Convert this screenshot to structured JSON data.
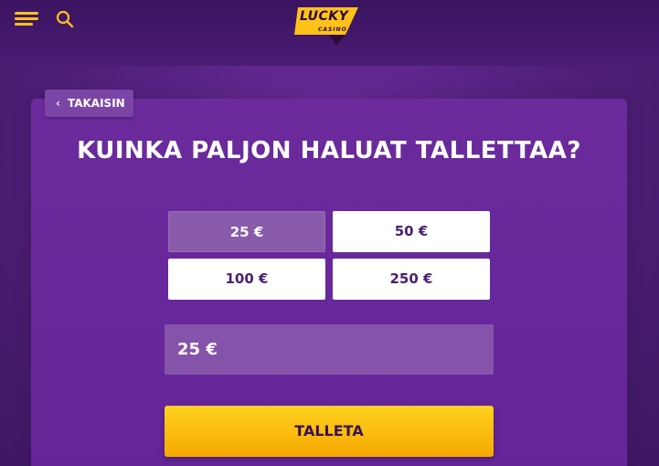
{
  "header": {
    "menu_icon": "hamburger-menu-icon",
    "search_icon": "search-icon",
    "logo": {
      "text": "LUCKY",
      "subtext": "CASINO"
    }
  },
  "back_button": {
    "label": "TAKAISIN",
    "icon": "chevron-left-icon"
  },
  "page_title": "KUINKA PALJON HALUAT TALLETTAA?",
  "amount_options": [
    {
      "label": "25 €",
      "selected": true
    },
    {
      "label": "50 €",
      "selected": false
    },
    {
      "label": "100 €",
      "selected": false
    },
    {
      "label": "250 €",
      "selected": false
    }
  ],
  "amount_input": {
    "value": "25 €"
  },
  "deposit_button": {
    "label": "TALLETA"
  },
  "colors": {
    "background": "#4f1f78",
    "card": "#6b2b9c",
    "accent_yellow": "#ffc21a",
    "selected_option": "#8a5aab",
    "option_text": "#4a1f70"
  }
}
